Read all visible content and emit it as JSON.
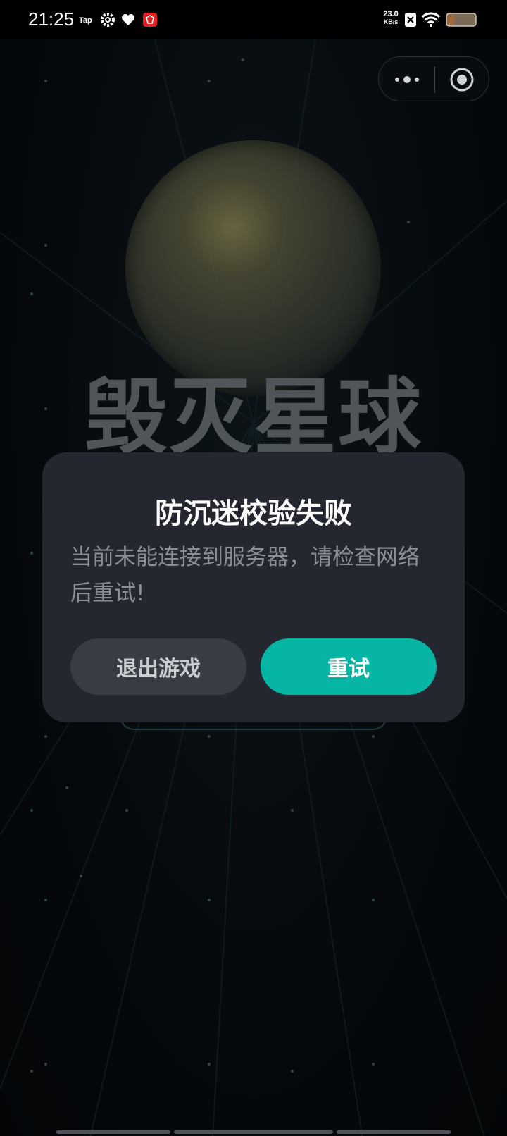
{
  "status_bar": {
    "time": "21:25",
    "net_speed_value": "23.0",
    "net_speed_unit": "KB/s",
    "icons": [
      "tap-app-icon",
      "settings-gear-icon",
      "heart-icon",
      "red-app-icon",
      "sim-x-icon",
      "wifi-icon",
      "battery-icon"
    ]
  },
  "capsule": {
    "icons": [
      "more-dots-icon",
      "close-target-icon"
    ]
  },
  "game": {
    "title": "毁灭星球"
  },
  "dialog": {
    "title": "防沉迷校验失败",
    "message": "当前未能连接到服务器，请检查网络后重试!",
    "exit_label": "退出游戏",
    "retry_label": "重试"
  },
  "colors": {
    "accent": "#07b5a4",
    "dialog_bg": "#24272f",
    "exit_btn_bg": "#393c43",
    "background": "#05080b"
  }
}
